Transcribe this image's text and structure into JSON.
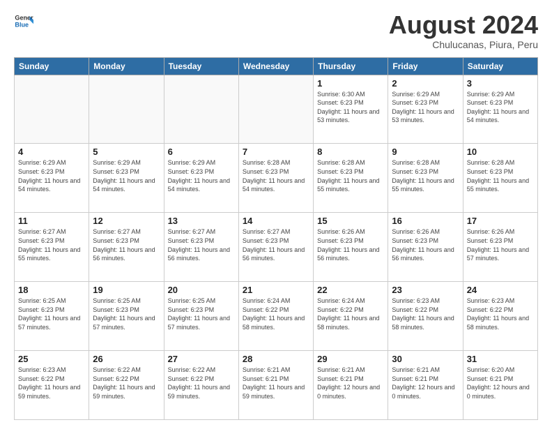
{
  "header": {
    "logo_general": "General",
    "logo_blue": "Blue",
    "title": "August 2024",
    "subtitle": "Chulucanas, Piura, Peru"
  },
  "days_of_week": [
    "Sunday",
    "Monday",
    "Tuesday",
    "Wednesday",
    "Thursday",
    "Friday",
    "Saturday"
  ],
  "weeks": [
    [
      {
        "day": "",
        "info": ""
      },
      {
        "day": "",
        "info": ""
      },
      {
        "day": "",
        "info": ""
      },
      {
        "day": "",
        "info": ""
      },
      {
        "day": "1",
        "info": "Sunrise: 6:30 AM\nSunset: 6:23 PM\nDaylight: 11 hours\nand 53 minutes."
      },
      {
        "day": "2",
        "info": "Sunrise: 6:29 AM\nSunset: 6:23 PM\nDaylight: 11 hours\nand 53 minutes."
      },
      {
        "day": "3",
        "info": "Sunrise: 6:29 AM\nSunset: 6:23 PM\nDaylight: 11 hours\nand 54 minutes."
      }
    ],
    [
      {
        "day": "4",
        "info": "Sunrise: 6:29 AM\nSunset: 6:23 PM\nDaylight: 11 hours\nand 54 minutes."
      },
      {
        "day": "5",
        "info": "Sunrise: 6:29 AM\nSunset: 6:23 PM\nDaylight: 11 hours\nand 54 minutes."
      },
      {
        "day": "6",
        "info": "Sunrise: 6:29 AM\nSunset: 6:23 PM\nDaylight: 11 hours\nand 54 minutes."
      },
      {
        "day": "7",
        "info": "Sunrise: 6:28 AM\nSunset: 6:23 PM\nDaylight: 11 hours\nand 54 minutes."
      },
      {
        "day": "8",
        "info": "Sunrise: 6:28 AM\nSunset: 6:23 PM\nDaylight: 11 hours\nand 55 minutes."
      },
      {
        "day": "9",
        "info": "Sunrise: 6:28 AM\nSunset: 6:23 PM\nDaylight: 11 hours\nand 55 minutes."
      },
      {
        "day": "10",
        "info": "Sunrise: 6:28 AM\nSunset: 6:23 PM\nDaylight: 11 hours\nand 55 minutes."
      }
    ],
    [
      {
        "day": "11",
        "info": "Sunrise: 6:27 AM\nSunset: 6:23 PM\nDaylight: 11 hours\nand 55 minutes."
      },
      {
        "day": "12",
        "info": "Sunrise: 6:27 AM\nSunset: 6:23 PM\nDaylight: 11 hours\nand 56 minutes."
      },
      {
        "day": "13",
        "info": "Sunrise: 6:27 AM\nSunset: 6:23 PM\nDaylight: 11 hours\nand 56 minutes."
      },
      {
        "day": "14",
        "info": "Sunrise: 6:27 AM\nSunset: 6:23 PM\nDaylight: 11 hours\nand 56 minutes."
      },
      {
        "day": "15",
        "info": "Sunrise: 6:26 AM\nSunset: 6:23 PM\nDaylight: 11 hours\nand 56 minutes."
      },
      {
        "day": "16",
        "info": "Sunrise: 6:26 AM\nSunset: 6:23 PM\nDaylight: 11 hours\nand 56 minutes."
      },
      {
        "day": "17",
        "info": "Sunrise: 6:26 AM\nSunset: 6:23 PM\nDaylight: 11 hours\nand 57 minutes."
      }
    ],
    [
      {
        "day": "18",
        "info": "Sunrise: 6:25 AM\nSunset: 6:23 PM\nDaylight: 11 hours\nand 57 minutes."
      },
      {
        "day": "19",
        "info": "Sunrise: 6:25 AM\nSunset: 6:23 PM\nDaylight: 11 hours\nand 57 minutes."
      },
      {
        "day": "20",
        "info": "Sunrise: 6:25 AM\nSunset: 6:23 PM\nDaylight: 11 hours\nand 57 minutes."
      },
      {
        "day": "21",
        "info": "Sunrise: 6:24 AM\nSunset: 6:22 PM\nDaylight: 11 hours\nand 58 minutes."
      },
      {
        "day": "22",
        "info": "Sunrise: 6:24 AM\nSunset: 6:22 PM\nDaylight: 11 hours\nand 58 minutes."
      },
      {
        "day": "23",
        "info": "Sunrise: 6:23 AM\nSunset: 6:22 PM\nDaylight: 11 hours\nand 58 minutes."
      },
      {
        "day": "24",
        "info": "Sunrise: 6:23 AM\nSunset: 6:22 PM\nDaylight: 11 hours\nand 58 minutes."
      }
    ],
    [
      {
        "day": "25",
        "info": "Sunrise: 6:23 AM\nSunset: 6:22 PM\nDaylight: 11 hours\nand 59 minutes."
      },
      {
        "day": "26",
        "info": "Sunrise: 6:22 AM\nSunset: 6:22 PM\nDaylight: 11 hours\nand 59 minutes."
      },
      {
        "day": "27",
        "info": "Sunrise: 6:22 AM\nSunset: 6:22 PM\nDaylight: 11 hours\nand 59 minutes."
      },
      {
        "day": "28",
        "info": "Sunrise: 6:21 AM\nSunset: 6:21 PM\nDaylight: 11 hours\nand 59 minutes."
      },
      {
        "day": "29",
        "info": "Sunrise: 6:21 AM\nSunset: 6:21 PM\nDaylight: 12 hours\nand 0 minutes."
      },
      {
        "day": "30",
        "info": "Sunrise: 6:21 AM\nSunset: 6:21 PM\nDaylight: 12 hours\nand 0 minutes."
      },
      {
        "day": "31",
        "info": "Sunrise: 6:20 AM\nSunset: 6:21 PM\nDaylight: 12 hours\nand 0 minutes."
      }
    ]
  ]
}
